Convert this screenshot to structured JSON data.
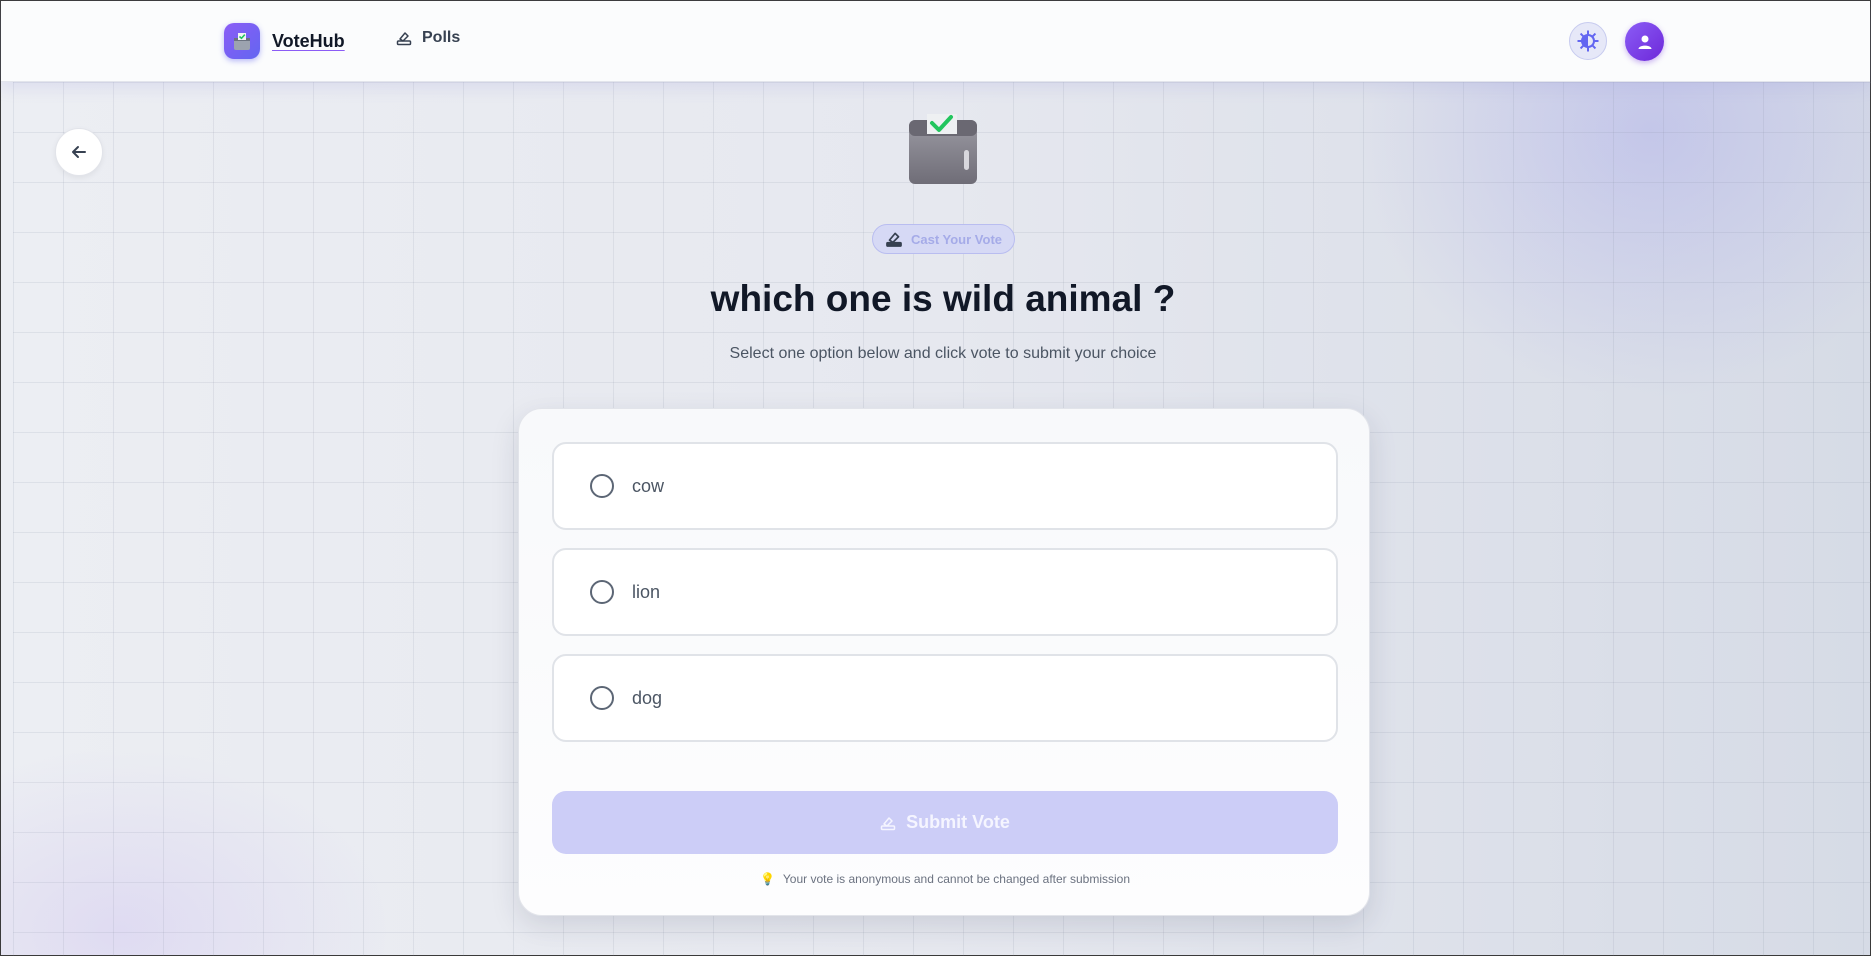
{
  "header": {
    "brand_name": "VoteHub",
    "nav": [
      {
        "label": "Polls",
        "icon": "ballot-pen-icon"
      }
    ],
    "theme_toggle_icon": "contrast-sun-icon",
    "avatar_icon": "user-icon"
  },
  "back_button_icon": "arrow-left-icon",
  "hero": {
    "icon": "ballot-box-with-check-icon",
    "badge_label": "Cast Your Vote",
    "title": "which one is wild animal ?",
    "subtitle": "Select one option below and click vote to submit your choice"
  },
  "options": [
    {
      "label": "cow",
      "selected": false
    },
    {
      "label": "lion",
      "selected": false
    },
    {
      "label": "dog",
      "selected": false
    }
  ],
  "submit": {
    "label": "Submit Vote",
    "disabled": true
  },
  "note": {
    "icon": "lightbulb-icon",
    "text": "Your vote is anonymous and cannot be changed after submission"
  },
  "colors": {
    "accent": "#6366f1",
    "brand_gradient_start": "#8b5cf6",
    "submit_disabled_bg": "#cccdf7",
    "title_text": "#111827"
  }
}
